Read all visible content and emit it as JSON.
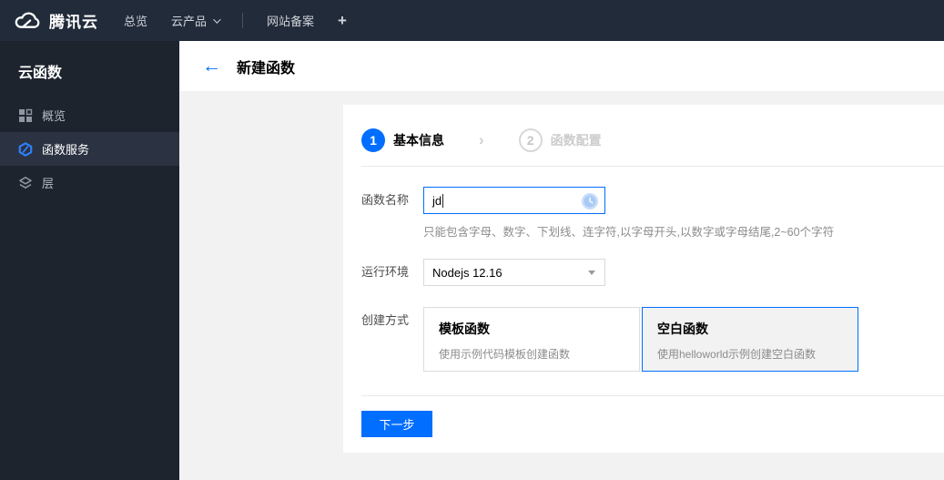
{
  "topbar": {
    "brand": "腾讯云",
    "items": [
      {
        "label": "总览"
      },
      {
        "label": "云产品"
      },
      {
        "label": "网站备案"
      }
    ],
    "add_label": "+"
  },
  "sidebar": {
    "title": "云函数",
    "items": [
      {
        "label": "概览",
        "icon": "grid-icon",
        "selected": false
      },
      {
        "label": "函数服务",
        "icon": "function-hexagon-icon",
        "selected": true
      },
      {
        "label": "层",
        "icon": "layers-icon",
        "selected": false
      }
    ]
  },
  "header": {
    "back_icon": "←",
    "title": "新建函数"
  },
  "wizard": {
    "separator": "›",
    "steps": [
      {
        "num": "1",
        "label": "基本信息",
        "active": true
      },
      {
        "num": "2",
        "label": "函数配置",
        "active": false
      }
    ]
  },
  "form": {
    "name": {
      "label": "函数名称",
      "value": "jd",
      "hint": "只能包含字母、数字、下划线、连字符,以字母开头,以数字或字母结尾,2~60个字符",
      "status_icon": "pending-clock-icon"
    },
    "runtime": {
      "label": "运行环境",
      "value": "Nodejs 12.16"
    },
    "method": {
      "label": "创建方式",
      "options": [
        {
          "title": "模板函数",
          "desc": "使用示例代码模板创建函数",
          "selected": false
        },
        {
          "title": "空白函数",
          "desc": "使用helloworld示例创建空白函数",
          "selected": true
        }
      ]
    }
  },
  "actions": {
    "next": "下一步"
  },
  "colors": {
    "accent": "#006eff",
    "topbar_bg": "#222b39",
    "sidebar_bg": "#1e242e",
    "content_bg": "#f2f2f2"
  }
}
